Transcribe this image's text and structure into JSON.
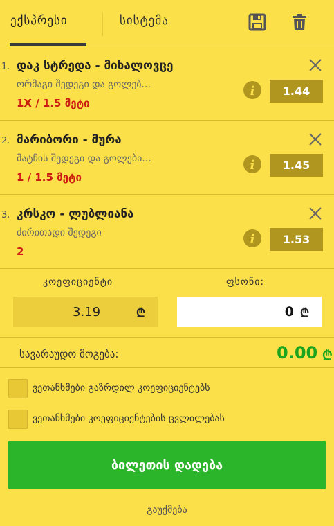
{
  "tabs": {
    "express": "ექსპრესი",
    "system": "სისტემა"
  },
  "bets": [
    {
      "num": "1.",
      "title": "დაკ სტრედა - მიხალოვცე",
      "market": "ორმაგი შედეგი და გოლებ...",
      "selection": "1X / 1.5 მეტი",
      "odds": "1.44"
    },
    {
      "num": "2.",
      "title": "მარიბორი - მურა",
      "market": "მატჩის შედეგი და გოლები...",
      "selection": "1 / 1.5 მეტი",
      "odds": "1.45"
    },
    {
      "num": "3.",
      "title": "კრსკო - ლუბლიანა",
      "market": "ძირითადი შედეგი",
      "selection": "2",
      "odds": "1.53"
    }
  ],
  "summary": {
    "coef_label": "კოეფიციენტი",
    "coef_value": "3.19",
    "stake_label": "ფსონი:",
    "stake_value": "0",
    "currency": "₾",
    "win_label": "სავარაუდო მოგება:",
    "win_value": "0.00"
  },
  "options": {
    "accept_higher": "ვეთანხმები გაზრდილ კოეფიციენტებს",
    "accept_changes": "ვეთანხმები კოეფიციენტების ცვლილებას"
  },
  "actions": {
    "place_bet": "ბილეთის დადება",
    "cancel": "გაუქმება"
  },
  "colors": {
    "background": "#fce04a",
    "odds_box": "#b0961f",
    "selection": "#cc1d12",
    "win": "#1ea51e",
    "place_button": "#2bb52b"
  },
  "icons": {
    "save": "floppy-disk-icon",
    "delete": "trash-icon",
    "close": "close-icon",
    "info": "info-icon",
    "currency": "lari-icon"
  }
}
